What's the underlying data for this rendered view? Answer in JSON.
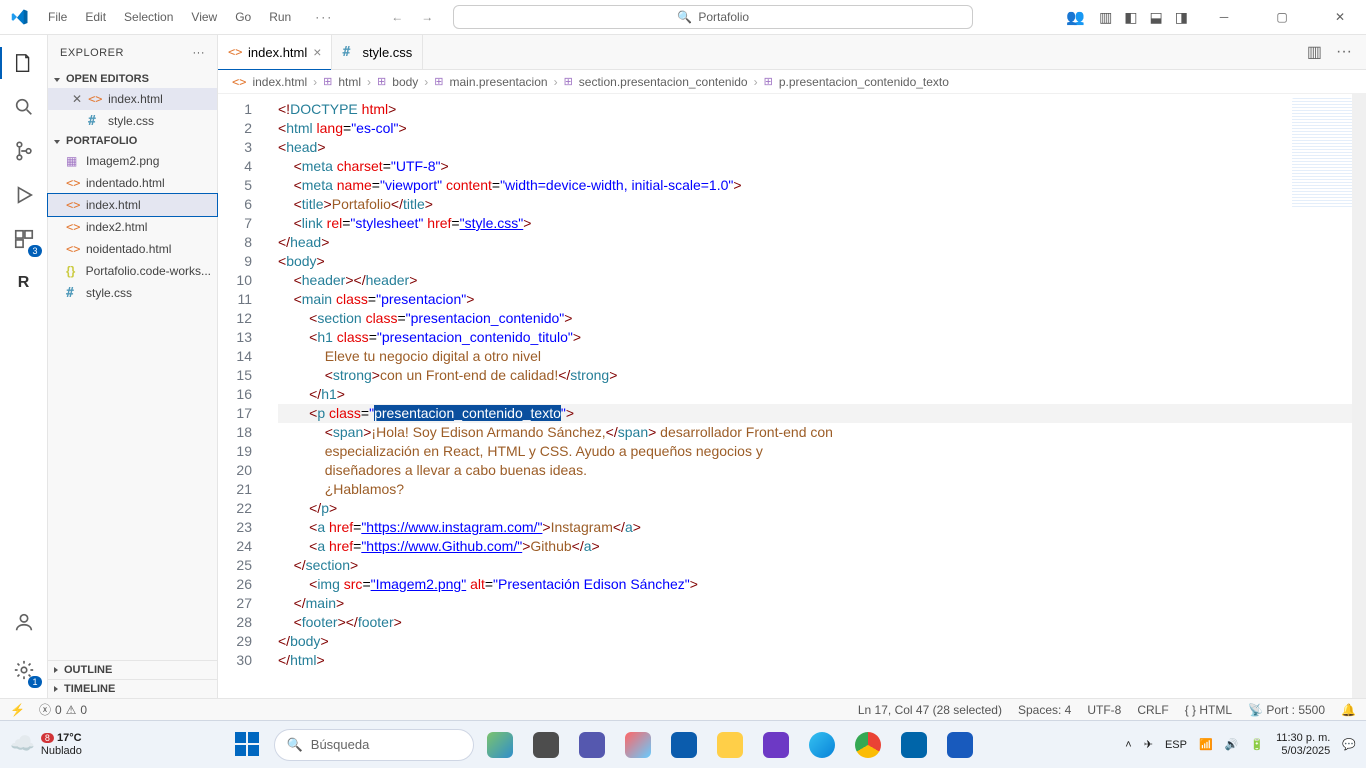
{
  "menu": {
    "file": "File",
    "edit": "Edit",
    "selection": "Selection",
    "view": "View",
    "go": "Go",
    "run": "Run"
  },
  "search": {
    "placeholder": "Portafolio"
  },
  "tabs": {
    "t1": "index.html",
    "t2": "style.css"
  },
  "explorer": {
    "title": "EXPLORER",
    "openEditors": "OPEN EDITORS",
    "oe1": "index.html",
    "oe2": "style.css",
    "folder": "PORTAFOLIO",
    "f1": "Imagem2.png",
    "f2": "indentado.html",
    "f3": "index.html",
    "f4": "index2.html",
    "f5": "noidentado.html",
    "f6": "Portafolio.code-works...",
    "f7": "style.css",
    "outline": "OUTLINE",
    "timeline": "TIMELINE"
  },
  "breadcrumb": {
    "b1": "index.html",
    "b2": "html",
    "b3": "body",
    "b4": "main.presentacion",
    "b5": "section.presentacion_contenido",
    "b6": "p.presentacion_contenido_texto"
  },
  "code": {
    "doctype": "<!DOCTYPE html>",
    "lang": "es-col",
    "charset": "UTF-8",
    "viewport": "width=device-width, initial-scale=1.0",
    "title": "Portafolio",
    "css": "style.css",
    "mainClass": "presentacion",
    "sectionClass": "presentacion_contenido",
    "h1Class": "presentacion_contenido_titulo",
    "h1Text": "Eleve tu negocio digital a otro nivel",
    "strongText": "con un Front-end de calidad!",
    "pClass": "presentacion_contenido_texto",
    "spanText": "¡Hola! Soy Edison Armando Sánchez,",
    "restText": " desarrollador Front-end con",
    "line19": "especialización en React, HTML y CSS. Ayudo a pequeños negocios y",
    "line20": "diseñadores a llevar a cabo buenas ideas.",
    "line21": "¿Hablamos?",
    "igUrl": "https://www.instagram.com/",
    "igText": "Instagram",
    "ghUrl": "https://www.Github.com/",
    "ghText": "Github",
    "imgSrc": "Imagem2.png",
    "imgAlt": "Presentación Edison Sánchez"
  },
  "lines": [
    "1",
    "2",
    "3",
    "4",
    "5",
    "6",
    "7",
    "8",
    "9",
    "10",
    "11",
    "12",
    "13",
    "14",
    "15",
    "16",
    "17",
    "18",
    "19",
    "20",
    "21",
    "22",
    "23",
    "24",
    "25",
    "26",
    "27",
    "28",
    "29",
    "30"
  ],
  "status": {
    "errors": "0",
    "warnings": "0",
    "lncol": "Ln 17, Col 47 (28 selected)",
    "spaces": "Spaces: 4",
    "enc": "UTF-8",
    "eol": "CRLF",
    "lang": "{ } HTML",
    "port": "Port : 5500"
  },
  "taskbar": {
    "temp": "17°C",
    "cond": "Nublado",
    "search": "Búsqueda",
    "kbd": "ESP",
    "time": "11:30 p. m.",
    "date": "5/03/2025",
    "badge": "8"
  }
}
